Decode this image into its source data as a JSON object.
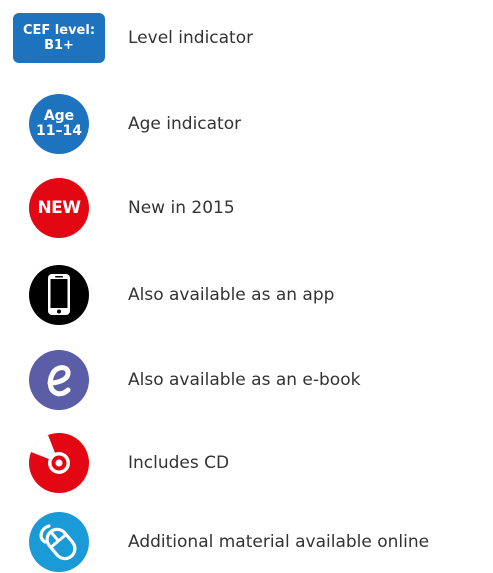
{
  "legend": {
    "items": [
      {
        "badge_line1": "CEF level:",
        "badge_line2": "B1+",
        "icon": "cef-level-badge",
        "color": "#1e73be",
        "label": "Level indicator"
      },
      {
        "badge_line1": "Age",
        "badge_line2": "11–14",
        "icon": "age-badge",
        "color": "#1e73be",
        "label": "Age indicator"
      },
      {
        "badge_text": "NEW",
        "icon": "new-badge",
        "color": "#e30613",
        "label": "New in 2015"
      },
      {
        "icon": "smartphone-icon",
        "color": "#000000",
        "label": "Also available as an app"
      },
      {
        "icon": "ebook-icon",
        "color": "#5b5ea6",
        "label": "Also available as an e-book"
      },
      {
        "icon": "cd-icon",
        "color": "#e30613",
        "label": "Includes CD"
      },
      {
        "icon": "mouse-online-icon",
        "color": "#1a9ad6",
        "label": "Additional material available online"
      }
    ]
  }
}
